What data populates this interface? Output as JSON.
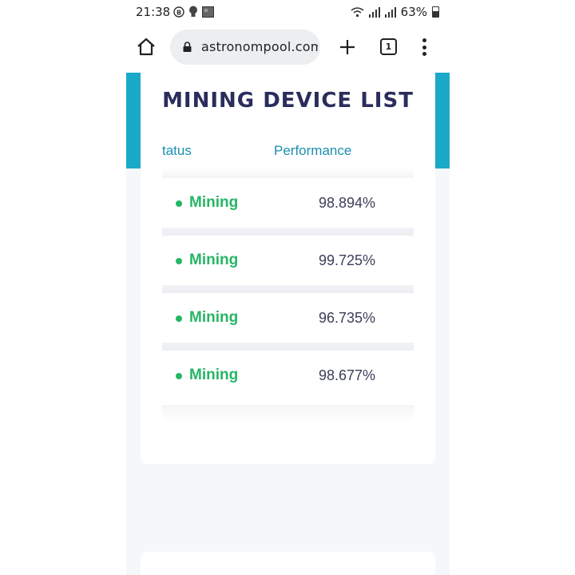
{
  "status_bar": {
    "time": "21:38",
    "signal_text": "63%",
    "icons": [
      "b-circle-icon",
      "bulb-icon",
      "gallery-icon",
      "wifi-icon",
      "signal-icon",
      "signal-icon",
      "battery-icon"
    ]
  },
  "browser": {
    "url": "astronompool.com/",
    "tab_count": "1",
    "buttons": [
      "home-icon",
      "lock-icon",
      "plus-icon",
      "tabs-icon",
      "menu-icon"
    ]
  },
  "page": {
    "title": "MINING DEVICE LIST",
    "columns": [
      "tatus",
      "Performance"
    ],
    "rows": [
      {
        "status": "Mining",
        "performance": "98.894%"
      },
      {
        "status": "Mining",
        "performance": "99.725%"
      },
      {
        "status": "Mining",
        "performance": "96.735%"
      },
      {
        "status": "Mining",
        "performance": "98.677%"
      }
    ],
    "colors": {
      "accent": "#1ba9c9",
      "title": "#2a2d5c",
      "status_ok": "#27b566",
      "header": "#1a8fb0"
    }
  }
}
